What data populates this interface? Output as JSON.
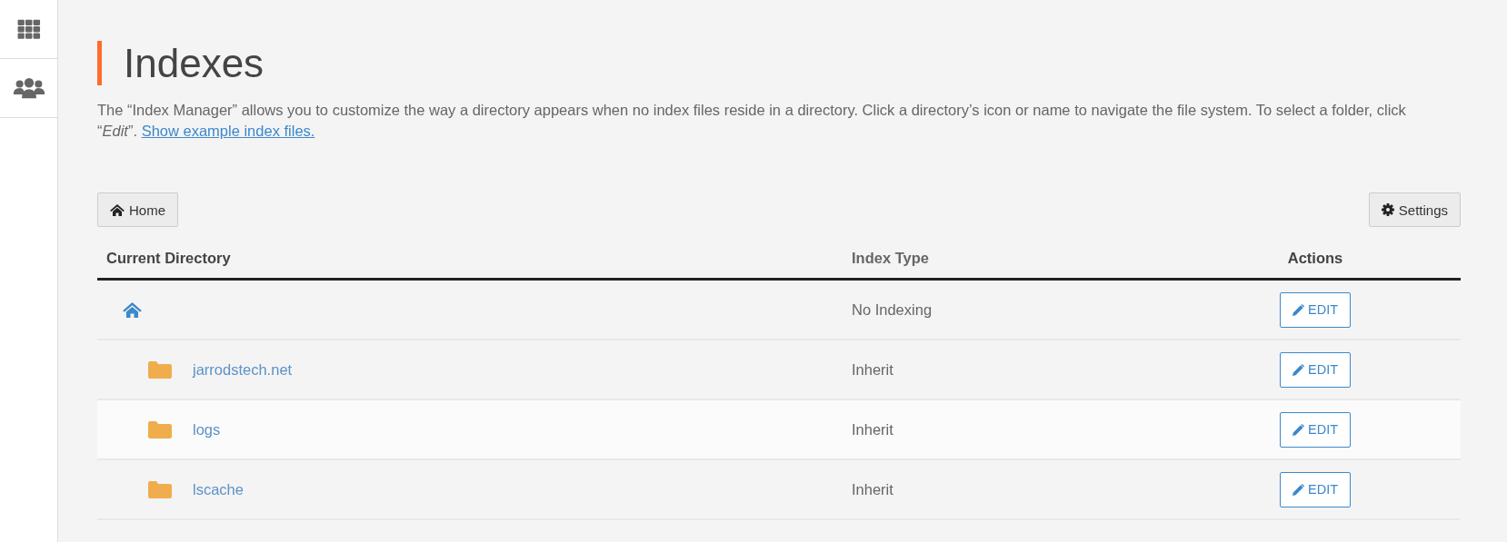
{
  "page": {
    "title": "Indexes",
    "description": "The “Index Manager” allows you to customize the way a directory appears when no index files reside in a directory. Click a directory’s icon or name to navigate the file system. To select a folder, click “*Edit*”.",
    "description_link": "Show example index files."
  },
  "toolbar": {
    "home_button": "Home",
    "settings_button": "Settings"
  },
  "table": {
    "columns": [
      "Current Directory",
      "Index Type",
      "Actions"
    ],
    "rows": [
      {
        "kind": "home",
        "index_type": "No Indexing",
        "action": "EDIT"
      },
      {
        "kind": "folder",
        "name": "jarrodstech.net",
        "index_type": "Inherit",
        "action": "EDIT"
      },
      {
        "kind": "folder",
        "name": "logs",
        "index_type": "Inherit",
        "action": "EDIT"
      },
      {
        "kind": "folder",
        "name": "lscache",
        "index_type": "Inherit",
        "action": "EDIT"
      }
    ]
  }
}
